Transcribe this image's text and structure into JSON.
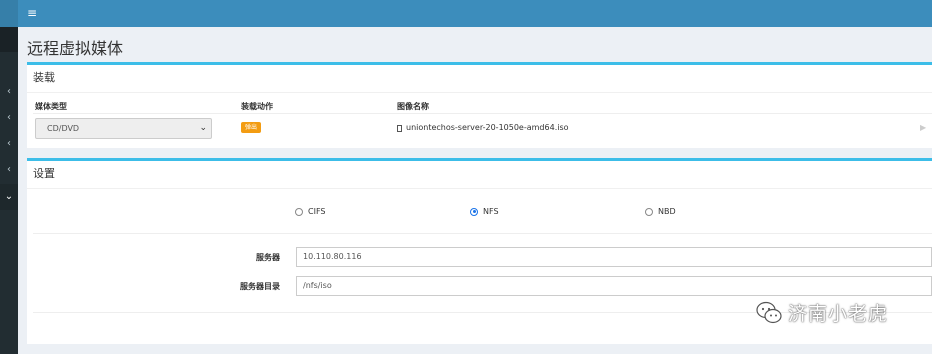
{
  "topbar": {
    "menu_icon": "hamburger-icon",
    "menu_glyph": "≡"
  },
  "sidebar": {
    "items": [
      {
        "icon": "chevron-left-icon",
        "glyph": "‹"
      },
      {
        "icon": "chevron-left-icon",
        "glyph": "‹"
      },
      {
        "icon": "chevron-left-icon",
        "glyph": "‹"
      },
      {
        "icon": "chevron-left-icon",
        "glyph": "‹"
      },
      {
        "icon": "chevron-down-icon",
        "glyph": "⌄"
      }
    ]
  },
  "page": {
    "title": "远程虚拟媒体"
  },
  "mount": {
    "header": "装载",
    "columns": {
      "media_type": "媒体类型",
      "mount_action": "装载动作",
      "image_name": "图像名称"
    },
    "media_type_value": "CD/DVD",
    "action_label": "弹出",
    "image_file": "uniontechos-server-20-1050e-amd64.iso",
    "play_glyph": "▶"
  },
  "settings": {
    "header": "设置",
    "protocols": [
      {
        "label": "CIFS",
        "checked": false
      },
      {
        "label": "NFS",
        "checked": true
      },
      {
        "label": "NBD",
        "checked": false
      }
    ],
    "server_label": "服务器",
    "server_value": "10.110.80.116",
    "dir_label": "服务器目录",
    "dir_value": "/nfs/iso"
  },
  "watermark": {
    "text": "济南小老虎"
  },
  "colors": {
    "topbar": "#3c8dbc",
    "sidebar": "#222d32",
    "accent": "#3cbde8",
    "warning": "#f39c12",
    "radio": "#1a73e8"
  }
}
